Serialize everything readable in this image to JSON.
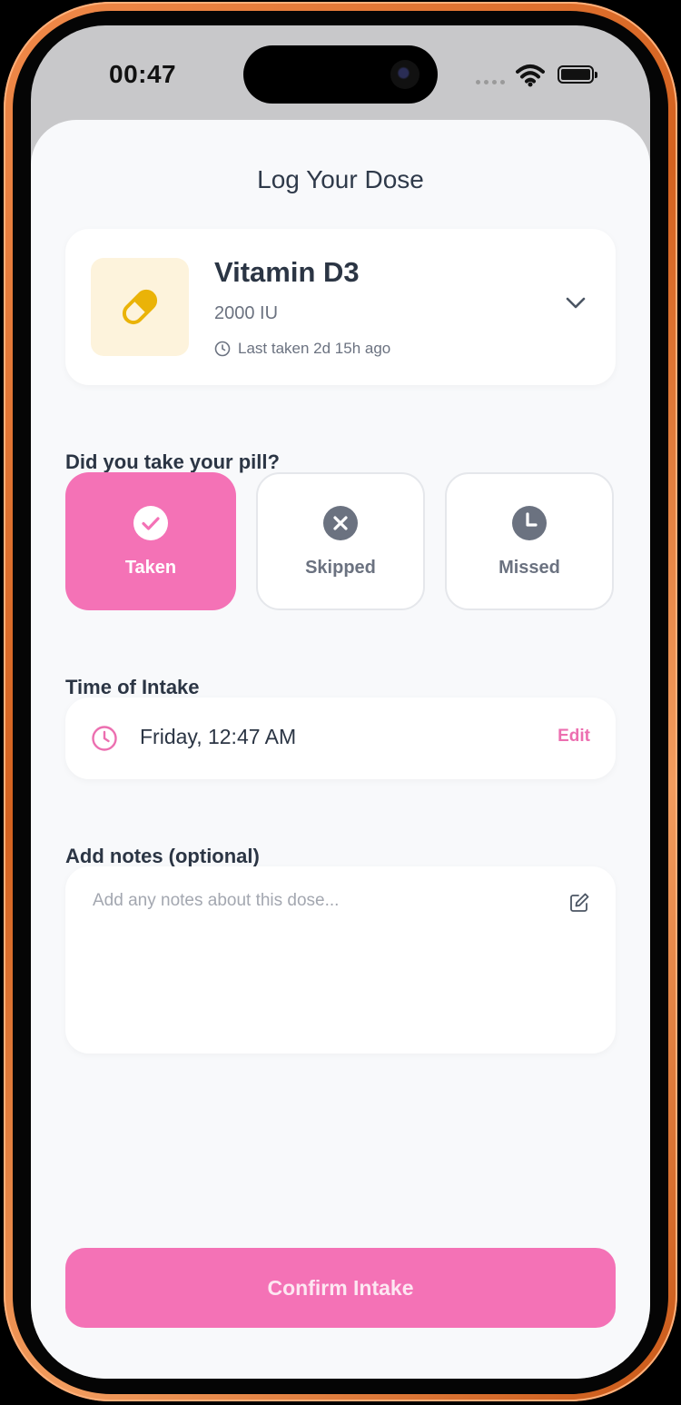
{
  "status_bar": {
    "time": "00:47"
  },
  "header": {
    "title": "Log Your Dose"
  },
  "medication": {
    "name": "Vitamin D3",
    "dose": "2000 IU",
    "last_taken": "Last taken 2d 15h ago",
    "icon": "pill-icon"
  },
  "intake_status": {
    "question": "Did you take your pill?",
    "options": [
      {
        "label": "Taken",
        "icon": "check-circle-icon",
        "selected": true
      },
      {
        "label": "Skipped",
        "icon": "x-circle-icon",
        "selected": false
      },
      {
        "label": "Missed",
        "icon": "clock-circle-icon",
        "selected": false
      }
    ]
  },
  "time_of_intake": {
    "label": "Time of Intake",
    "value": "Friday, 12:47 AM",
    "edit_label": "Edit"
  },
  "notes": {
    "label": "Add notes (optional)",
    "placeholder": "Add any notes about this dose...",
    "value": ""
  },
  "confirm_button": {
    "label": "Confirm Intake"
  },
  "colors": {
    "accent": "#f472b6",
    "text_dark": "#2b3544",
    "text_muted": "#6b7280",
    "pill_bg": "#fdf3dc",
    "pill": "#eab308"
  }
}
